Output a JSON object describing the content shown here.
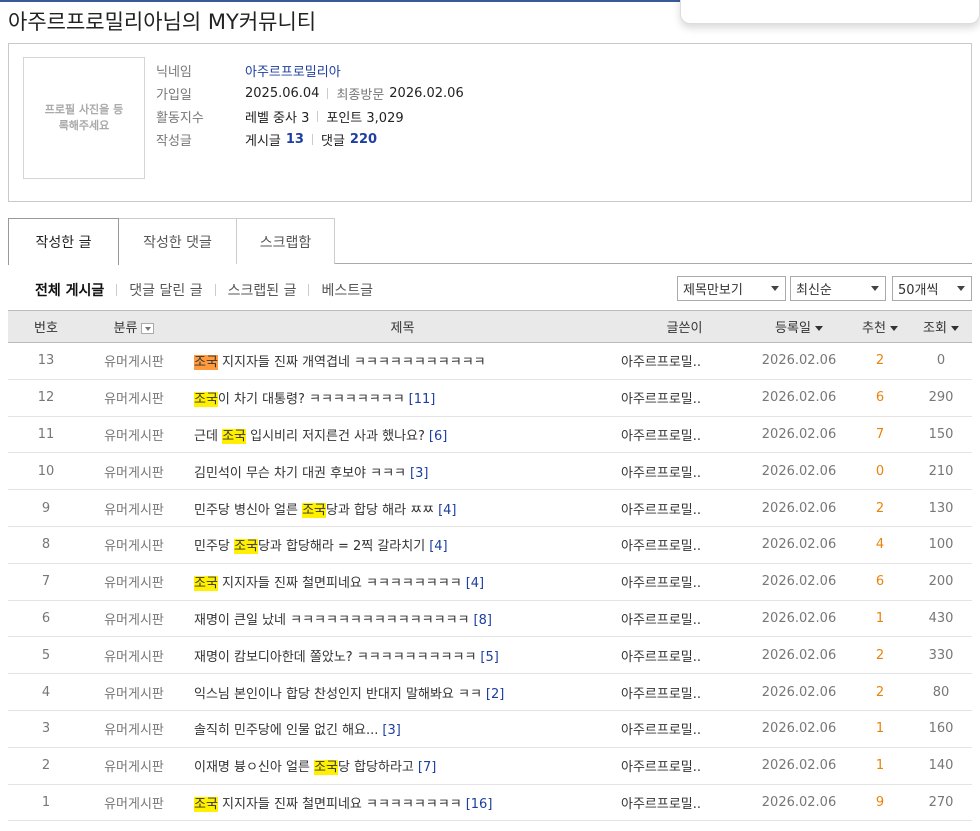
{
  "page_title": "아주르프로밀리아님의 MY커뮤니티",
  "profile": {
    "photo_placeholder": "프로필 사진을 등록해주세요",
    "nickname_label": "닉네임",
    "nickname": "아주르프로밀리아",
    "joined_label": "가입일",
    "joined": "2025.06.04",
    "last_visit_label": "최종방문",
    "last_visit": "2026.02.06",
    "activity_label": "활동지수",
    "level": "레벨 중사 3",
    "points": "포인트 3,029",
    "written_label": "작성글",
    "posts_label": "게시글",
    "posts_count": "13",
    "comments_label": "댓글",
    "comments_count": "220"
  },
  "tabs": [
    "작성한 글",
    "작성한 댓글",
    "스크랩함"
  ],
  "filters": [
    "전체 게시글",
    "댓글 달린 글",
    "스크랩된 글",
    "베스트글"
  ],
  "selects": {
    "view_mode": "제목만보기",
    "sort": "최신순",
    "per_page": "50개씩"
  },
  "columns": {
    "num": "번호",
    "category": "분류",
    "title": "제목",
    "author": "글쓴이",
    "date": "등록일",
    "recommend": "추천",
    "views": "조회"
  },
  "highlight_term": "조국",
  "rows": [
    {
      "num": "13",
      "category": "유머게시판",
      "pre": "",
      "hl": "조국",
      "post": " 지지자들 진짜 개역겹네 ㅋㅋㅋㅋㅋㅋㅋㅋㅋㅋㅋ",
      "comments": "",
      "author": "아주르프로밀..",
      "date": "2026.02.06",
      "rec": "2",
      "views": "0"
    },
    {
      "num": "12",
      "category": "유머게시판",
      "pre": "",
      "hl": "조국",
      "post": "이 차기 대통령? ㅋㅋㅋㅋㅋㅋㅋㅋ",
      "comments": "[11]",
      "author": "아주르프로밀..",
      "date": "2026.02.06",
      "rec": "6",
      "views": "290"
    },
    {
      "num": "11",
      "category": "유머게시판",
      "pre": "근데 ",
      "hl": "조국",
      "post": " 입시비리 저지른건 사과 했나요?",
      "comments": "[6]",
      "author": "아주르프로밀..",
      "date": "2026.02.06",
      "rec": "7",
      "views": "150"
    },
    {
      "num": "10",
      "category": "유머게시판",
      "pre": "김민석이 무슨 차기 대권 후보야 ㅋㅋㅋ",
      "hl": "",
      "post": "",
      "comments": "[3]",
      "author": "아주르프로밀..",
      "date": "2026.02.06",
      "rec": "0",
      "views": "210"
    },
    {
      "num": "9",
      "category": "유머게시판",
      "pre": "민주당 병신아 얼른 ",
      "hl": "조국",
      "post": "당과 합당 해라 ㅉㅉ",
      "comments": "[4]",
      "author": "아주르프로밀..",
      "date": "2026.02.06",
      "rec": "2",
      "views": "130"
    },
    {
      "num": "8",
      "category": "유머게시판",
      "pre": "민주당 ",
      "hl": "조국",
      "post": "당과 합당해라 = 2찍 갈라치기",
      "comments": "[4]",
      "author": "아주르프로밀..",
      "date": "2026.02.06",
      "rec": "4",
      "views": "100"
    },
    {
      "num": "7",
      "category": "유머게시판",
      "pre": "",
      "hl": "조국",
      "post": " 지지자들 진짜 철면피네요 ㅋㅋㅋㅋㅋㅋㅋㅋ",
      "comments": "[4]",
      "author": "아주르프로밀..",
      "date": "2026.02.06",
      "rec": "6",
      "views": "200"
    },
    {
      "num": "6",
      "category": "유머게시판",
      "pre": "재명이 큰일 났네 ㅋㅋㅋㅋㅋㅋㅋㅋㅋㅋㅋㅋㅋㅋㅋ",
      "hl": "",
      "post": "",
      "comments": "[8]",
      "author": "아주르프로밀..",
      "date": "2026.02.06",
      "rec": "1",
      "views": "430"
    },
    {
      "num": "5",
      "category": "유머게시판",
      "pre": "재명이 캄보디아한데 쫄았노? ㅋㅋㅋㅋㅋㅋㅋㅋㅋㅋ",
      "hl": "",
      "post": "",
      "comments": "[5]",
      "author": "아주르프로밀..",
      "date": "2026.02.06",
      "rec": "2",
      "views": "330"
    },
    {
      "num": "4",
      "category": "유머게시판",
      "pre": "익스님 본인이나 합당 찬성인지 반대지 말해봐요 ㅋㅋ",
      "hl": "",
      "post": "",
      "comments": "[2]",
      "author": "아주르프로밀..",
      "date": "2026.02.06",
      "rec": "2",
      "views": "80"
    },
    {
      "num": "3",
      "category": "유머게시판",
      "pre": "솔직히 민주당에 인물 없긴 해요...",
      "hl": "",
      "post": "",
      "comments": "[3]",
      "author": "아주르프로밀..",
      "date": "2026.02.06",
      "rec": "1",
      "views": "160"
    },
    {
      "num": "2",
      "category": "유머게시판",
      "pre": "이재명 븅ㅇ신아 얼른 ",
      "hl": "조국",
      "post": "당 합당하라고",
      "comments": "[7]",
      "author": "아주르프로밀..",
      "date": "2026.02.06",
      "rec": "1",
      "views": "140"
    },
    {
      "num": "1",
      "category": "유머게시판",
      "pre": "",
      "hl": "조국",
      "post": " 지지자들 진짜 철면피네요 ㅋㅋㅋㅋㅋㅋㅋㅋ",
      "comments": "[16]",
      "author": "아주르프로밀..",
      "date": "2026.02.06",
      "rec": "9",
      "views": "270"
    }
  ]
}
